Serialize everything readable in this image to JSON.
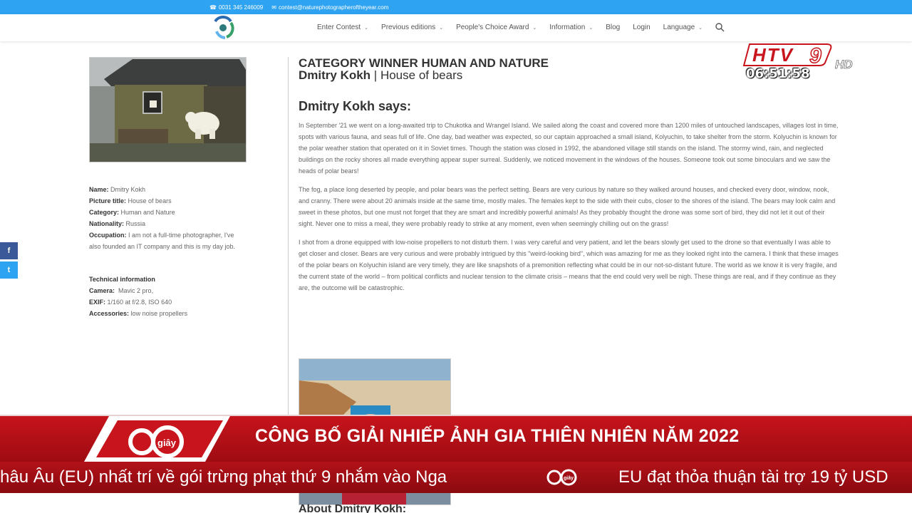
{
  "topbar": {
    "phone": "0031 345 246009",
    "email": "contest@naturephotographeroftheyear.com"
  },
  "nav": {
    "items": [
      {
        "label": "Enter Contest",
        "dropdown": true
      },
      {
        "label": "Previous editions",
        "dropdown": true
      },
      {
        "label": "People's Choice Award",
        "dropdown": true
      },
      {
        "label": "Information",
        "dropdown": true
      },
      {
        "label": "Blog",
        "dropdown": false
      },
      {
        "label": "Login",
        "dropdown": false
      },
      {
        "label": "Language",
        "dropdown": true
      }
    ]
  },
  "details": {
    "name_label": "Name:",
    "name": "Dmitry Kokh",
    "title_label": "Picture title:",
    "title": "House of bears",
    "category_label": "Category:",
    "category": "Human and Nature",
    "nationality_label": "Nationality:",
    "nationality": "Russia",
    "occupation_label": "Occupation:",
    "occupation": "I am not a full-time photographer, I've also founded an IT company and this is my day job."
  },
  "technical": {
    "heading": "Technical information",
    "camera_label": "Camera:",
    "camera": "Mavic 2 pro,",
    "exif_label": "EXIF:",
    "exif": "1/160 at f/2.8, ISO 640",
    "accessories_label": "Accessories:",
    "accessories": "low noise propellers"
  },
  "social": {
    "facebook": "f",
    "twitter": "t"
  },
  "article": {
    "category_heading": "CATEGORY WINNER HUMAN AND NATURE",
    "photographer": "Dmitry Kokh",
    "separator": " | ",
    "photo_title": "House of bears",
    "says_heading": "Dmitry Kokh says:",
    "paragraphs": [
      "In September '21 we went on a long-awaited trip to Chukotka and Wrangel Island. We sailed along the coast and covered more than 1200 miles of untouched landscapes, villages lost in time, spots with various fauna, and seas full of life. One day, bad weather was expected, so our captain approached a small island, Kolyuchin, to take shelter from the storm. Kolyuchin is known for the polar weather station that operated on it in Soviet times. Though the station was closed in 1992, the abandoned village still stands on the island. The stormy wind, rain, and neglected buildings on the rocky shores all made everything appear super surreal. Suddenly, we noticed movement in the windows of the houses. Someone took out some binoculars and we saw the heads of polar bears!",
      "The fog, a place long deserted by people, and polar bears was the perfect setting. Bears are very curious by nature so they walked around houses, and checked every door, window, nook, and cranny. There were about 20 animals inside at the same time, mostly males. The females kept to the side with their cubs, closer to the shores of the island. The bears may look calm and sweet in these photos, but one must not forget that they are smart and incredibly powerful animals! As they probably thought the drone was some sort of bird, they did not let it out of their sight. Never one to miss a meal, they were probably ready to strike at any moment, even when seemingly chilling out on the grass!",
      "I shot from a drone equipped with low-noise propellers to not disturb them. I was very careful and very patient, and let the bears slowly get used to the drone so that eventually I was able to get closer and closer. Bears are very curious and were probably intrigued by this \"weird-looking bird\", which was amazing for me as they looked right into the camera. I think that these images of the polar bears on Kolyuchin island are very timely, they are like snapshots of a premonition reflecting what could be in our not-so-distant future. The world as we know it is very fragile, and the current state of the world – from political conflicts and nuclear tension to the climate crisis – means that the end could very well be nigh. These things are real, and if they continue as they are, the outcome will be catastrophic."
    ],
    "about_heading": "About Dmitry Kokh:"
  },
  "broadcast": {
    "channel": "HTV9",
    "hd": "HD",
    "clock": "06:51:58",
    "program_logo_number": "60",
    "program_logo_word": "giây",
    "headline": "CÔNG BỐ GIẢI NHIẾP ẢNH GIA THIÊN NHIÊN NĂM 2022",
    "ticker_left": "hâu Âu (EU) nhất trí về gói trừng phạt thứ 9 nhắm vào Nga",
    "ticker_right": "EU đạt thỏa thuận tài trợ 19 tỷ USD",
    "colors": {
      "banner_red": "#c8141c",
      "site_blue": "#2ea3f2"
    }
  }
}
